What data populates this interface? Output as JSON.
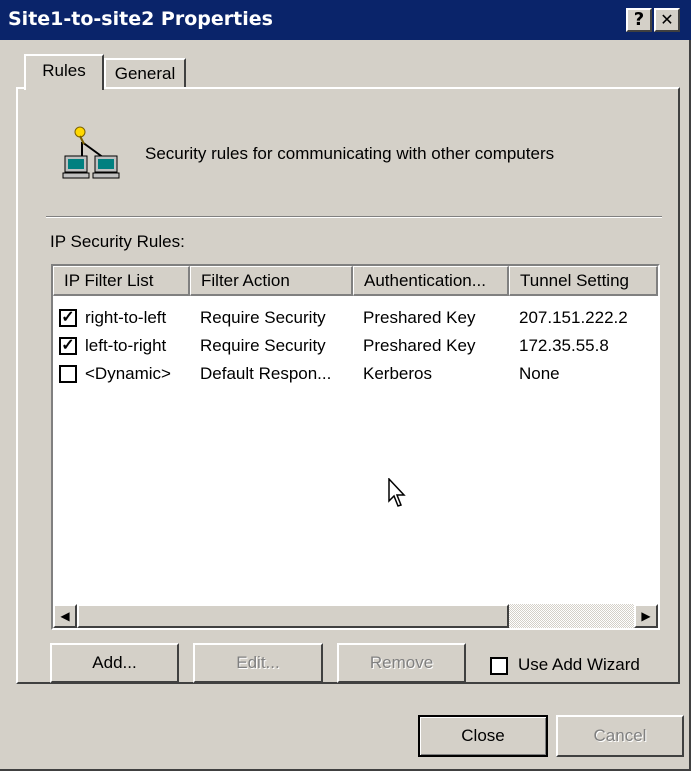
{
  "window": {
    "title": "Site1-to-site2 Properties",
    "help_glyph": "?",
    "close_glyph": "✕"
  },
  "tabs": [
    {
      "label": "Rules"
    },
    {
      "label": "General"
    }
  ],
  "description": "Security rules for communicating with other computers",
  "rules_label": "IP Security Rules:",
  "columns": [
    "IP Filter List",
    "Filter Action",
    "Authentication...",
    "Tunnel Setting"
  ],
  "rows": [
    {
      "checked": true,
      "check_glyph": "✓",
      "filter": "right-to-left",
      "action": "Require Security",
      "auth": "Preshared Key",
      "tunnel": "207.151.222.2"
    },
    {
      "checked": true,
      "check_glyph": "✓",
      "filter": "left-to-right",
      "action": "Require Security",
      "auth": "Preshared Key",
      "tunnel": "172.35.55.8"
    },
    {
      "checked": false,
      "check_glyph": "",
      "filter": "<Dynamic>",
      "action": "Default Respon...",
      "auth": "Kerberos",
      "tunnel": "None"
    }
  ],
  "scroll": {
    "left_glyph": "◀",
    "right_glyph": "▶"
  },
  "buttons": {
    "add": "Add...",
    "edit": "Edit...",
    "remove": "Remove",
    "close": "Close",
    "cancel": "Cancel"
  },
  "wizard_label": "Use Add Wizard",
  "colors": {
    "titlebar": "#0a246a",
    "face": "#d4d0c8"
  },
  "icons": {
    "header_icon": "network-computers-icon",
    "cursor": "mouse-pointer-icon"
  }
}
